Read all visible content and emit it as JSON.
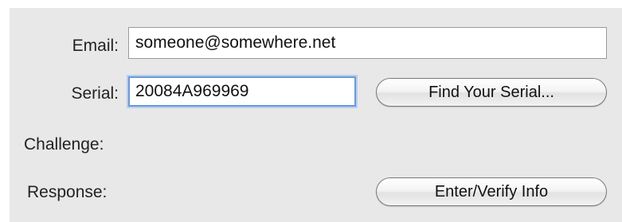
{
  "form": {
    "email_label": "Email:",
    "email_value": "someone@somewhere.net",
    "serial_label": "Serial:",
    "serial_value": "20084A969969",
    "find_serial_button": "Find Your Serial...",
    "challenge_label": "Challenge:",
    "response_label": "Response:",
    "enter_verify_button": "Enter/Verify Info"
  },
  "colors": {
    "panel_background": "#e8e8e8",
    "focus_ring": "#6c98d6"
  }
}
